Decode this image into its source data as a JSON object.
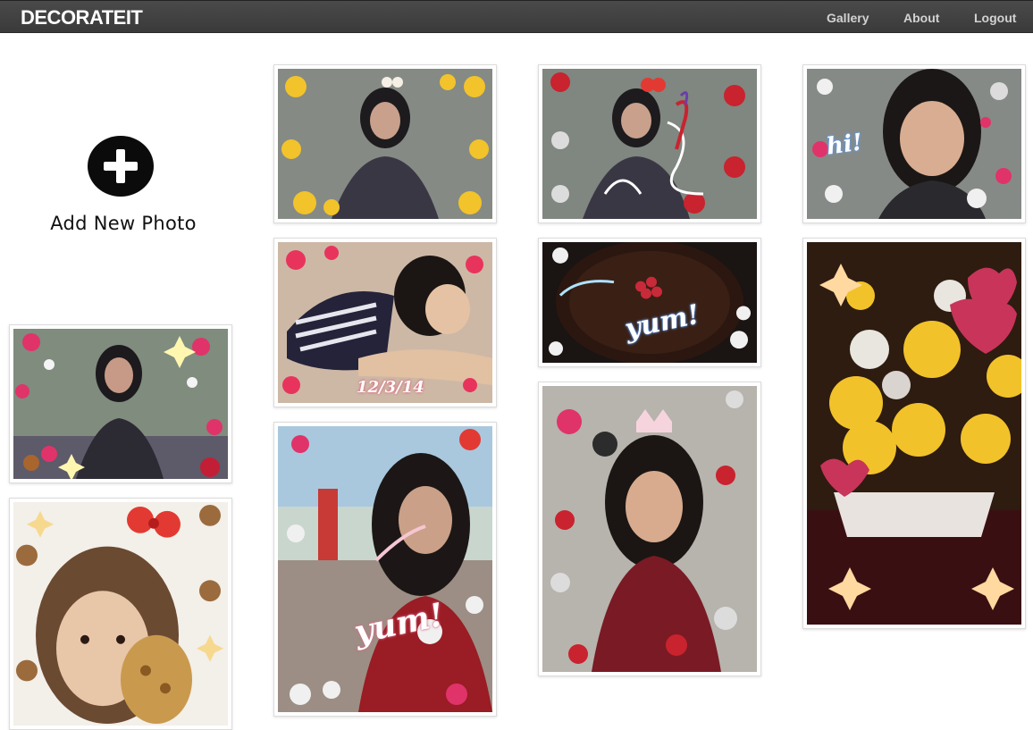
{
  "navbar": {
    "brand": "DECORATEIT",
    "links": [
      "Gallery",
      "About",
      "Logout"
    ]
  },
  "add_photo": {
    "label": "Add New Photo",
    "icon": "plus-circle-icon"
  },
  "photo_overlays": {
    "date_stamp": "12/3/14",
    "yum_cake": "yum!",
    "yum_red": "yum!",
    "hi": "hi!"
  },
  "colors": {
    "navbar_bg": "#3f3f3f",
    "brand": "#ffffff",
    "nav_link": "#d2d2d2",
    "page_bg": "#ffffff"
  }
}
